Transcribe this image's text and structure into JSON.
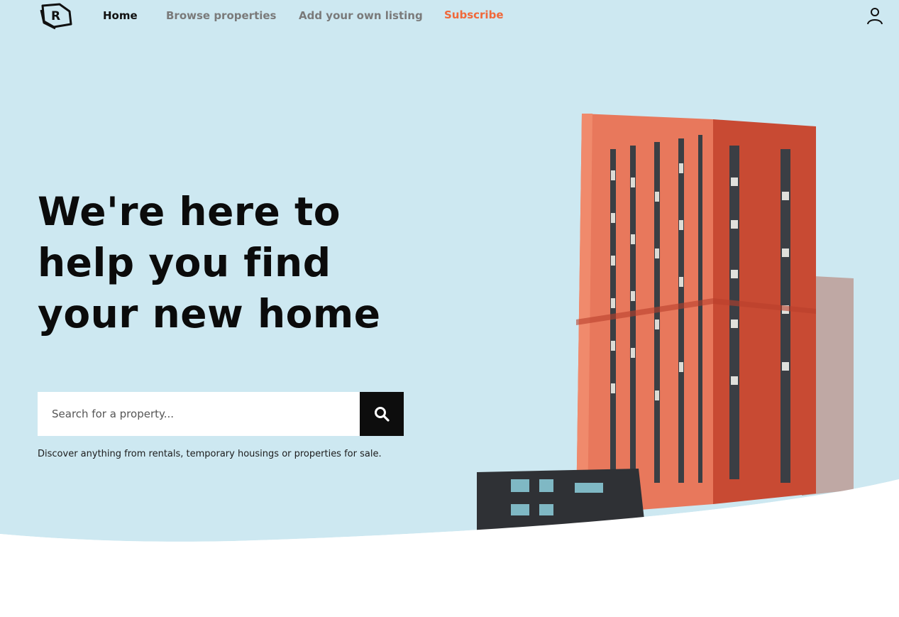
{
  "nav": {
    "home_label": "Home",
    "browse_label": "Browse properties",
    "add_label": "Add your own listing",
    "subscribe_label": "Subscribe"
  },
  "hero": {
    "headline_line1": "We're here to",
    "headline_line2": "help you find",
    "headline_line3": "your new home",
    "search_placeholder": "Search for a property...",
    "hint": "Discover anything from rentals, temporary housings or properties for sale."
  },
  "colors": {
    "hero_background": "#cde8f1",
    "accent": "#f0683a",
    "search_button": "#0d0d0d",
    "building_orange": "#e8785c",
    "building_red": "#c84a33"
  },
  "icons": {
    "logo": "logo-icon",
    "user": "user-icon",
    "search": "search-icon"
  }
}
